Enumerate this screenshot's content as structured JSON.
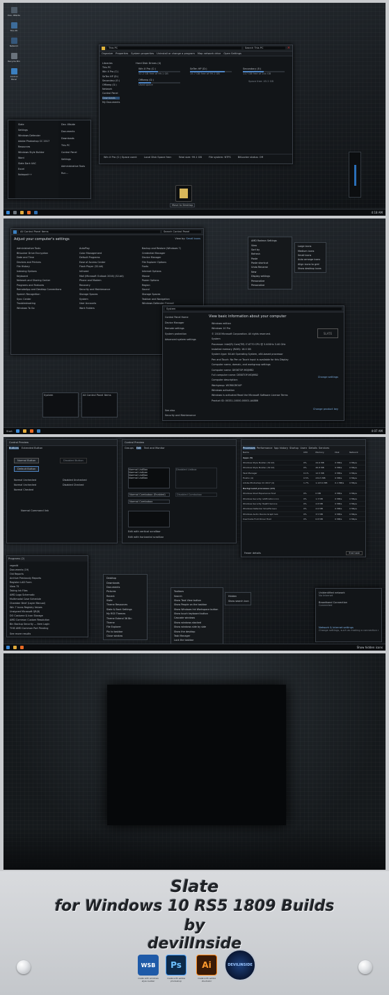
{
  "p1": {
    "desktop_icons": [
      "Dev. ilNside",
      "This PC",
      "Network",
      "Recycle Bin",
      "Control Panel"
    ],
    "explorer": {
      "address": "This PC",
      "search": "Search This PC",
      "ribbon": [
        "Organize",
        "Properties",
        "System properties",
        "Uninstall or change a program",
        "Map network drive",
        "Open Settings"
      ],
      "nav": [
        "Libraries",
        "This PC",
        "Win X Pro (C:)",
        "SeTen HP (D:)",
        "Secondary (E:)",
        "Offkeep (G:)",
        "Network",
        "Control Panel",
        "Downloads",
        "My Documents"
      ],
      "section": "Hard Disk Drives (4)",
      "drives": [
        {
          "name": "Win X Pro (C:)",
          "free": "52.2 GB free of 99.1 GB",
          "used": 0.47
        },
        {
          "name": "SeTen HP (D:)",
          "free": "15.7 GB free of 99.1 GB",
          "used": 0.84
        },
        {
          "name": "Secondary (E:)",
          "free": "117 GB free of 2xx GB",
          "used": 0.5
        },
        {
          "name": "Offkeep (G:)",
          "free": "Used space",
          "used": 0.3
        }
      ],
      "details": [
        "Win X Pro (C:) Space used:",
        "Local Disk   Space free:",
        "Total size: 99.1 GB",
        "File system: NTFS",
        "BitLocker status: Off"
      ],
      "free_right": "Space free: 45.2 GB"
    },
    "start_menu": {
      "left": [
        "Slate",
        "Settings",
        "Windows Defender",
        "Adobe Photoshop CC 2017",
        "Resources",
        "Windows Style Builder",
        "Word",
        "Slate Dark UAC",
        "Excel",
        "Notepad++"
      ],
      "right": [
        "Dev. ilNside",
        "Documents",
        "Downloads",
        "This PC",
        "Control Panel",
        "Settings",
        "Administrative Tools",
        "Run..."
      ]
    },
    "tooltip": "Move to Desktop",
    "clock": "4:18 AM"
  },
  "p2": {
    "cp_title": "All Control Panel Items",
    "cp_search": "Search Control Panel",
    "cp_heading": "Adjust your computer's settings",
    "view_by": "View by:",
    "view_val": "Small icons",
    "col1": [
      "Administrative Tools",
      "BitLocker Drive Encryption",
      "Date and Time",
      "Devices and Printers",
      "File History",
      "Indexing Options",
      "Keyboard",
      "Network and Sharing Center",
      "Programs and Features",
      "RemoteApp and Desktop Connections",
      "Speech Recognition",
      "Sync Center",
      "Troubleshooting",
      "Windows To Go"
    ],
    "col2": [
      "AutoPlay",
      "Color Management",
      "Default Programs",
      "Ease of Access Center",
      "Flash Player (32-bit)",
      "Infrared",
      "Mail (Microsoft Outlook 2016) (32-bit)",
      "Phone and Modem",
      "Recovery",
      "Security and Maintenance",
      "Storage Spaces",
      "System",
      "User Accounts",
      "Work Folders"
    ],
    "col3": [
      "Backup and Restore (Windows 7)",
      "Credential Manager",
      "Device Manager",
      "File Explorer Options",
      "Fonts",
      "Internet Options",
      "Mouse",
      "Power Options",
      "Region",
      "Sound",
      "Storage Spaces",
      "Taskbar and Navigation",
      "Windows Defender Firewall"
    ],
    "context_menu": [
      "AMD Radeon Settings",
      "View",
      "Sort by",
      "Refresh",
      "Paste",
      "Paste shortcut",
      "Undo Rename",
      "New",
      "Display settings",
      "Personalize",
      "Personalize"
    ],
    "submenu": [
      "Large icons",
      "Medium icons",
      "Small icons",
      "Auto arrange icons",
      "Align icons to grid",
      "Show desktop icons"
    ],
    "sys_title": "System",
    "sys_heading": "View basic information about your computer",
    "sys_nav": [
      "Control Panel Home",
      "Device Manager",
      "Remote settings",
      "System protection",
      "Advanced system settings"
    ],
    "sys_see_also": [
      "See also",
      "Security and Maintenance"
    ],
    "sys_info": [
      "Windows edition",
      "Windows 10 Pro",
      "© 2018 Microsoft Corporation. All rights reserved.",
      "System",
      "Processor:  Intel(R) Core(TM) i7-6770 CPU @ 3.40GHz  3.40 GHz",
      "Installed memory (RAM):  16.0 GB",
      "System type:  64-bit Operating System, x64-based processor",
      "Pen and Touch:  No Pen or Touch Input is available for this Display",
      "Computer name, domain, and workgroup settings",
      "Computer name:  DESKTOP-MOJMB2",
      "Full computer name:  DESKTOP-MOJMB2",
      "Computer description:",
      "Workgroup:  WORKGROUP",
      "Windows activation",
      "Windows is activated   Read the Microsoft Software License Terms",
      "Product ID:  00331-10000-00001-AA886"
    ],
    "change_settings": "Change settings",
    "change_key": "Change product key",
    "slate": "SLATE",
    "thumbs": [
      "System",
      "All Control Panel Items"
    ],
    "start": "Start",
    "clock": "4:07 AM"
  },
  "p3": {
    "ctl_title": "Control Preview",
    "ctl_tabs": [
      "Buttons",
      "Extended Button"
    ],
    "buttons": [
      "Normal Button",
      "Default Button",
      "Disabled Button"
    ],
    "radios": [
      "Normal Unchecked",
      "Normal Unchecked",
      "Normal Checked",
      "Disabled Unchecked",
      "Disabled Checked"
    ],
    "check_label": "Normal Command link",
    "ctl2_tabs": [
      "Groups",
      "Edit",
      "Text and Monitor"
    ],
    "edit_items": [
      "Normal ListBox",
      "Normal Listbox",
      "Normal ListBox",
      "Normal ListBox",
      "Disabled Listbox",
      "Normal Combobox (Enabled)",
      "Normal Combobox",
      "Disabled Combobox"
    ],
    "progress_labels": [
      "Edit with vertical scrollbar",
      "Edit with horizontal scrollbar"
    ],
    "tm_tabs": [
      "Processes",
      "Performance",
      "App history",
      "Startup",
      "Users",
      "Details",
      "Services"
    ],
    "tm_header": [
      "Name",
      "CPU",
      "Memory",
      "Disk",
      "Network"
    ],
    "tm_pct": [
      "0%",
      "55%",
      "0%",
      "0%"
    ],
    "tm_apps_title": "Apps (5)",
    "tm_apps": [
      [
        "Windows Style Builder (32 bit)",
        "0%",
        "24.6 MB",
        "0 MB/s",
        "0 Mbps"
      ],
      [
        "Windows Style Builder (32 bit)",
        "0%",
        "26.8 MB",
        "0 MB/s",
        "0 Mbps"
      ],
      [
        "Task Manager",
        "0.1%",
        "12.5 MB",
        "0 MB/s",
        "0 Mbps"
      ],
      [
        "Firefox (4)",
        "0.5%",
        "234.5 MB",
        "0 MB/s",
        "0 Mbps"
      ],
      [
        "Adobe Photoshop CC 2017 (4)",
        "1.7%",
        "1,123.9 MB",
        "0.1 MB/s",
        "0 Mbps"
      ]
    ],
    "tm_bg_title": "Background processes (24)",
    "tm_bg": [
      [
        "Windows Shell Experience Host",
        "0%",
        "0 MB",
        "0 MB/s",
        "0 Mbps"
      ],
      [
        "Windows Security notification icon",
        "0%",
        "1.3 MB",
        "0 MB/s",
        "0 Mbps"
      ],
      [
        "Windows Security Health Service",
        "0%",
        "2.8 MB",
        "0 MB/s",
        "0 Mbps"
      ],
      [
        "Windows Defender SmartScreen",
        "0%",
        "2.6 MB",
        "0 MB/s",
        "0 Mbps"
      ],
      [
        "Windows Audio Device Graph Isol.",
        "0%",
        "3.5 MB",
        "0 MB/s",
        "0 Mbps"
      ],
      [
        "Usermode Font Driver Host",
        "0%",
        "0.8 MB",
        "0 MB/s",
        "0 Mbps"
      ]
    ],
    "fewer": "Fewer details",
    "end_task": "End task",
    "prog_title": "Programs (2)",
    "prog_items": [
      "regedit",
      "Documents (19)",
      "Old Reports",
      "Archive Previously Reports",
      "Register LAD Form",
      "View 75",
      "Taking Ink Files",
      "AMD Logo Schematic",
      "Multimodal Case Schedule",
      "Chamber Brief (Layer Manual)",
      "Win 7 Icons Registry Values",
      "Unsigned Microsoft QR(8)",
      "DO Costume & Icon Storage",
      "AMD Common Custom Resolution",
      "Bin Backup Security — Item Login",
      "THIS AMD Common Part Pending"
    ],
    "see_more": "See more results",
    "jump_title": "Pinned",
    "jump_items": [
      "Desktop",
      "Downloads",
      "Documents",
      "Pictures",
      "Recent",
      "Slate",
      "Theme Resources",
      "Slate & Back Settings",
      "My RS5 Themes",
      "Theme Extend 36 Bin",
      "Theme",
      "File Explorer",
      "Pin to taskbar",
      "Close window"
    ],
    "tb_menu": [
      "Toolbars",
      "Search",
      "Show Task View button",
      "Show People on the taskbar",
      "Show Windows Ink Workspace button",
      "Show touch keyboard button",
      "Cascade windows",
      "Show windows stacked",
      "Show windows side by side",
      "Show the desktop",
      "Task Manager",
      "Lock the taskbar",
      "Taskbar settings"
    ],
    "tb_sub": [
      "Hidden",
      "Show search icon"
    ],
    "net": [
      "Unidentified network",
      "No Internet",
      "Broadband Connection",
      "Connected",
      "Network & Internet settings",
      "Change settings, such as making a connection metered."
    ],
    "tray": "Show hidden icons"
  },
  "title": {
    "lines": [
      "Slate",
      "for Windows 10 RS5 1809 Builds",
      "by",
      "devilInside"
    ],
    "logos": [
      {
        "mark": "WSB",
        "caption": "made with windows style builder",
        "color": "#1e5aa8"
      },
      {
        "mark": "Ps",
        "caption": "made with adobe photoshop",
        "color": "#0d2a4a"
      },
      {
        "mark": "Ai",
        "caption": "made with adobe illustrator",
        "color": "#3a1a06"
      },
      {
        "mark": "DEVILINSIDE",
        "caption": "",
        "color": "#0e2b5c"
      }
    ]
  }
}
